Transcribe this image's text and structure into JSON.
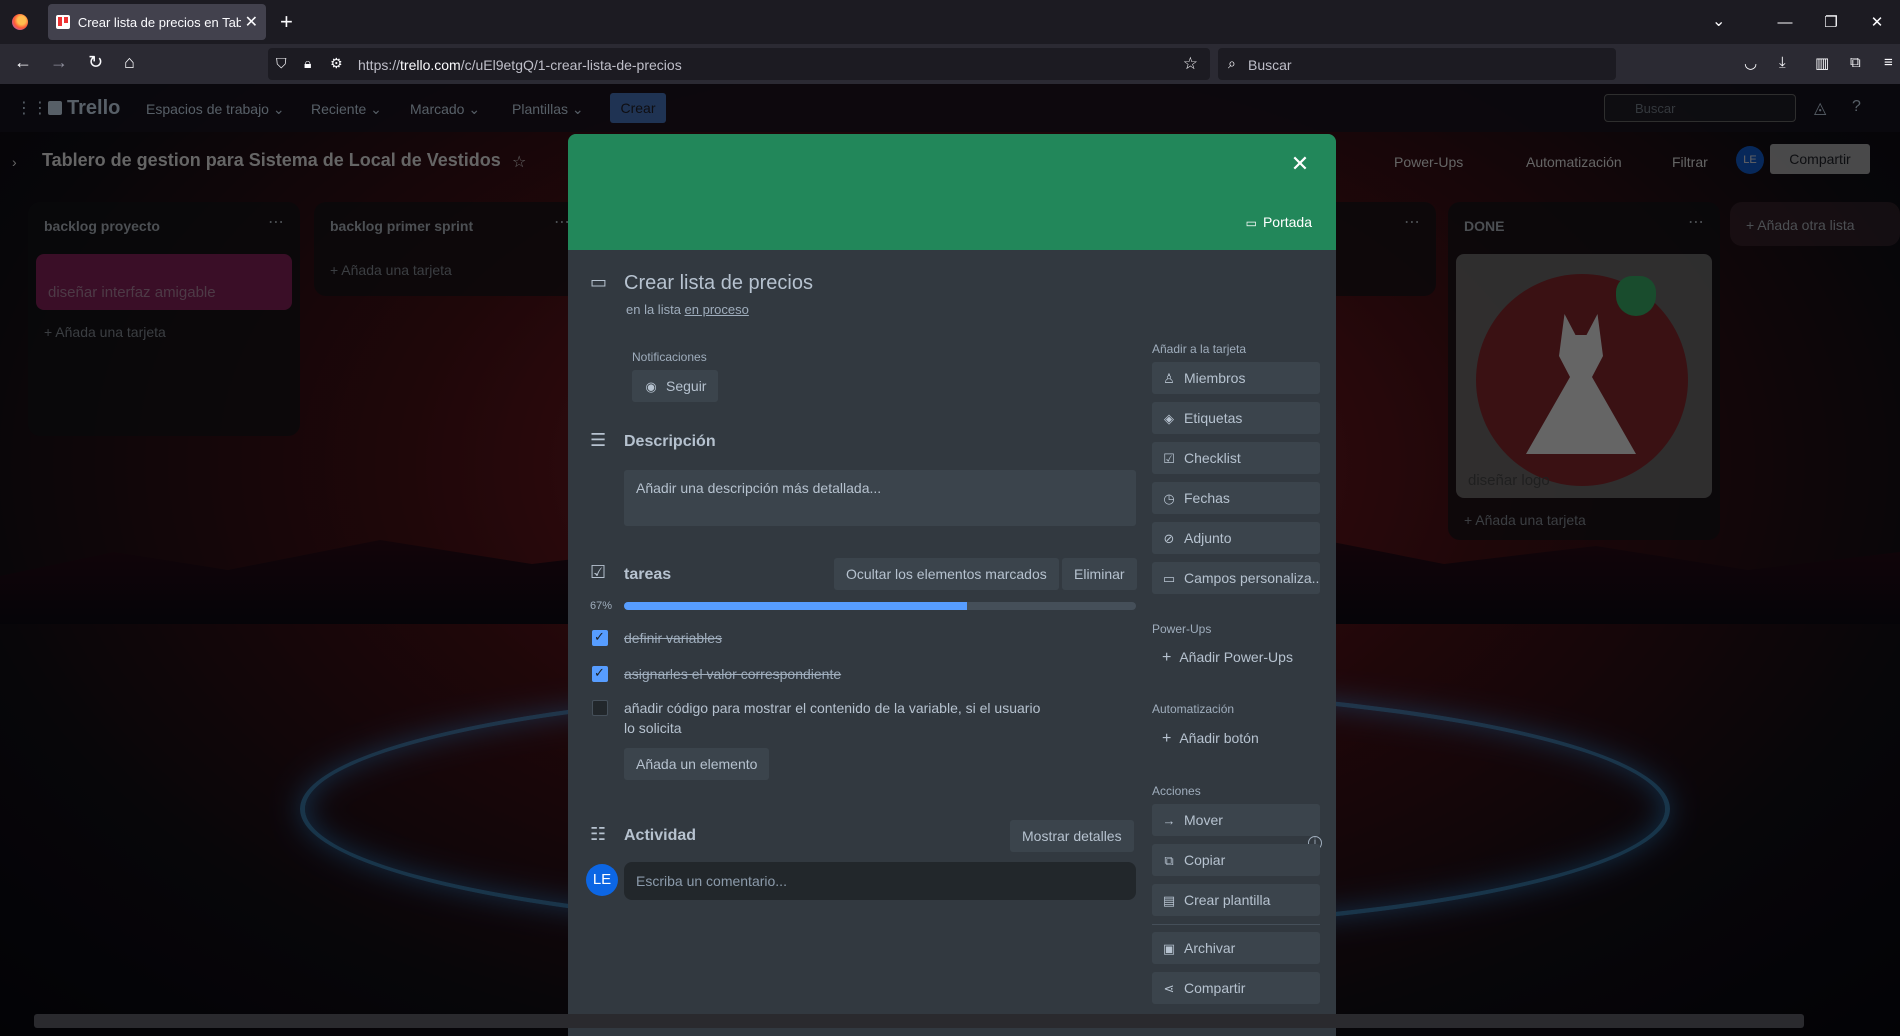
{
  "browser": {
    "tab_title": "Crear lista de precios en Tablero",
    "tab_close": "✕",
    "new_tab": "+",
    "url_prefix": "https://",
    "url_domain": "trello.com",
    "url_path": "/c/uEl9etgQ/1-crear-lista-de-precios",
    "search_placeholder": "Buscar"
  },
  "trello_header": {
    "logo": "Trello",
    "menus": [
      "Espacios de trabajo ⌄",
      "Reciente ⌄",
      "Marcado ⌄",
      "Plantillas ⌄"
    ],
    "create": "Crear",
    "search_placeholder": "Buscar",
    "avatar": "LE"
  },
  "board": {
    "title": "Tablero de gestion para Sistema de Local de Vestidos",
    "powerups": "Power-Ups",
    "automation": "Automatización",
    "filter": "Filtrar",
    "share": "Compartir",
    "avatar": "LE",
    "lists": [
      {
        "title": "backlog proyecto",
        "card": "diseñar interfaz amigable",
        "add": "Añada una tarjeta"
      },
      {
        "title": "backlog primer sprint",
        "add": "Añada una tarjeta"
      },
      {
        "title": "DONE",
        "card": "diseñar logo",
        "add": "Añada una tarjeta"
      }
    ],
    "add_list": "Añada otra lista"
  },
  "card": {
    "cover_button": "Portada",
    "title": "Crear lista de precios",
    "in_list_prefix": "en la lista",
    "list_link": "en proceso",
    "notifications_label": "Notificaciones",
    "follow": "Seguir",
    "description_title": "Descripción",
    "description_placeholder": "Añadir una descripción más detallada...",
    "checklist": {
      "title": "tareas",
      "hide_checked": "Ocultar los elementos marcados",
      "delete": "Eliminar",
      "percent_label": "67%",
      "progress": 0.67,
      "items": [
        {
          "text": "definir variables",
          "done": true
        },
        {
          "text": "asignarles el valor correspondiente",
          "done": true
        },
        {
          "text": "añadir código para mostrar el contenido de la variable, si el usuario lo solicita",
          "done": false
        }
      ],
      "add_item": "Añada un elemento"
    },
    "activity_title": "Actividad",
    "show_details": "Mostrar detalles",
    "avatar": "LE",
    "comment_placeholder": "Escriba un comentario..."
  },
  "sidebar": {
    "add_to_card_label": "Añadir a la tarjeta",
    "add_to_card": [
      "Miembros",
      "Etiquetas",
      "Checklist",
      "Fechas",
      "Adjunto",
      "Campos personaliza..."
    ],
    "powerups_label": "Power-Ups",
    "add_powerups": "Añadir Power-Ups",
    "automation_label": "Automatización",
    "add_button": "Añadir botón",
    "actions_label": "Acciones",
    "actions": [
      "Mover",
      "Copiar",
      "Crear plantilla",
      "Archivar",
      "Compartir"
    ]
  }
}
